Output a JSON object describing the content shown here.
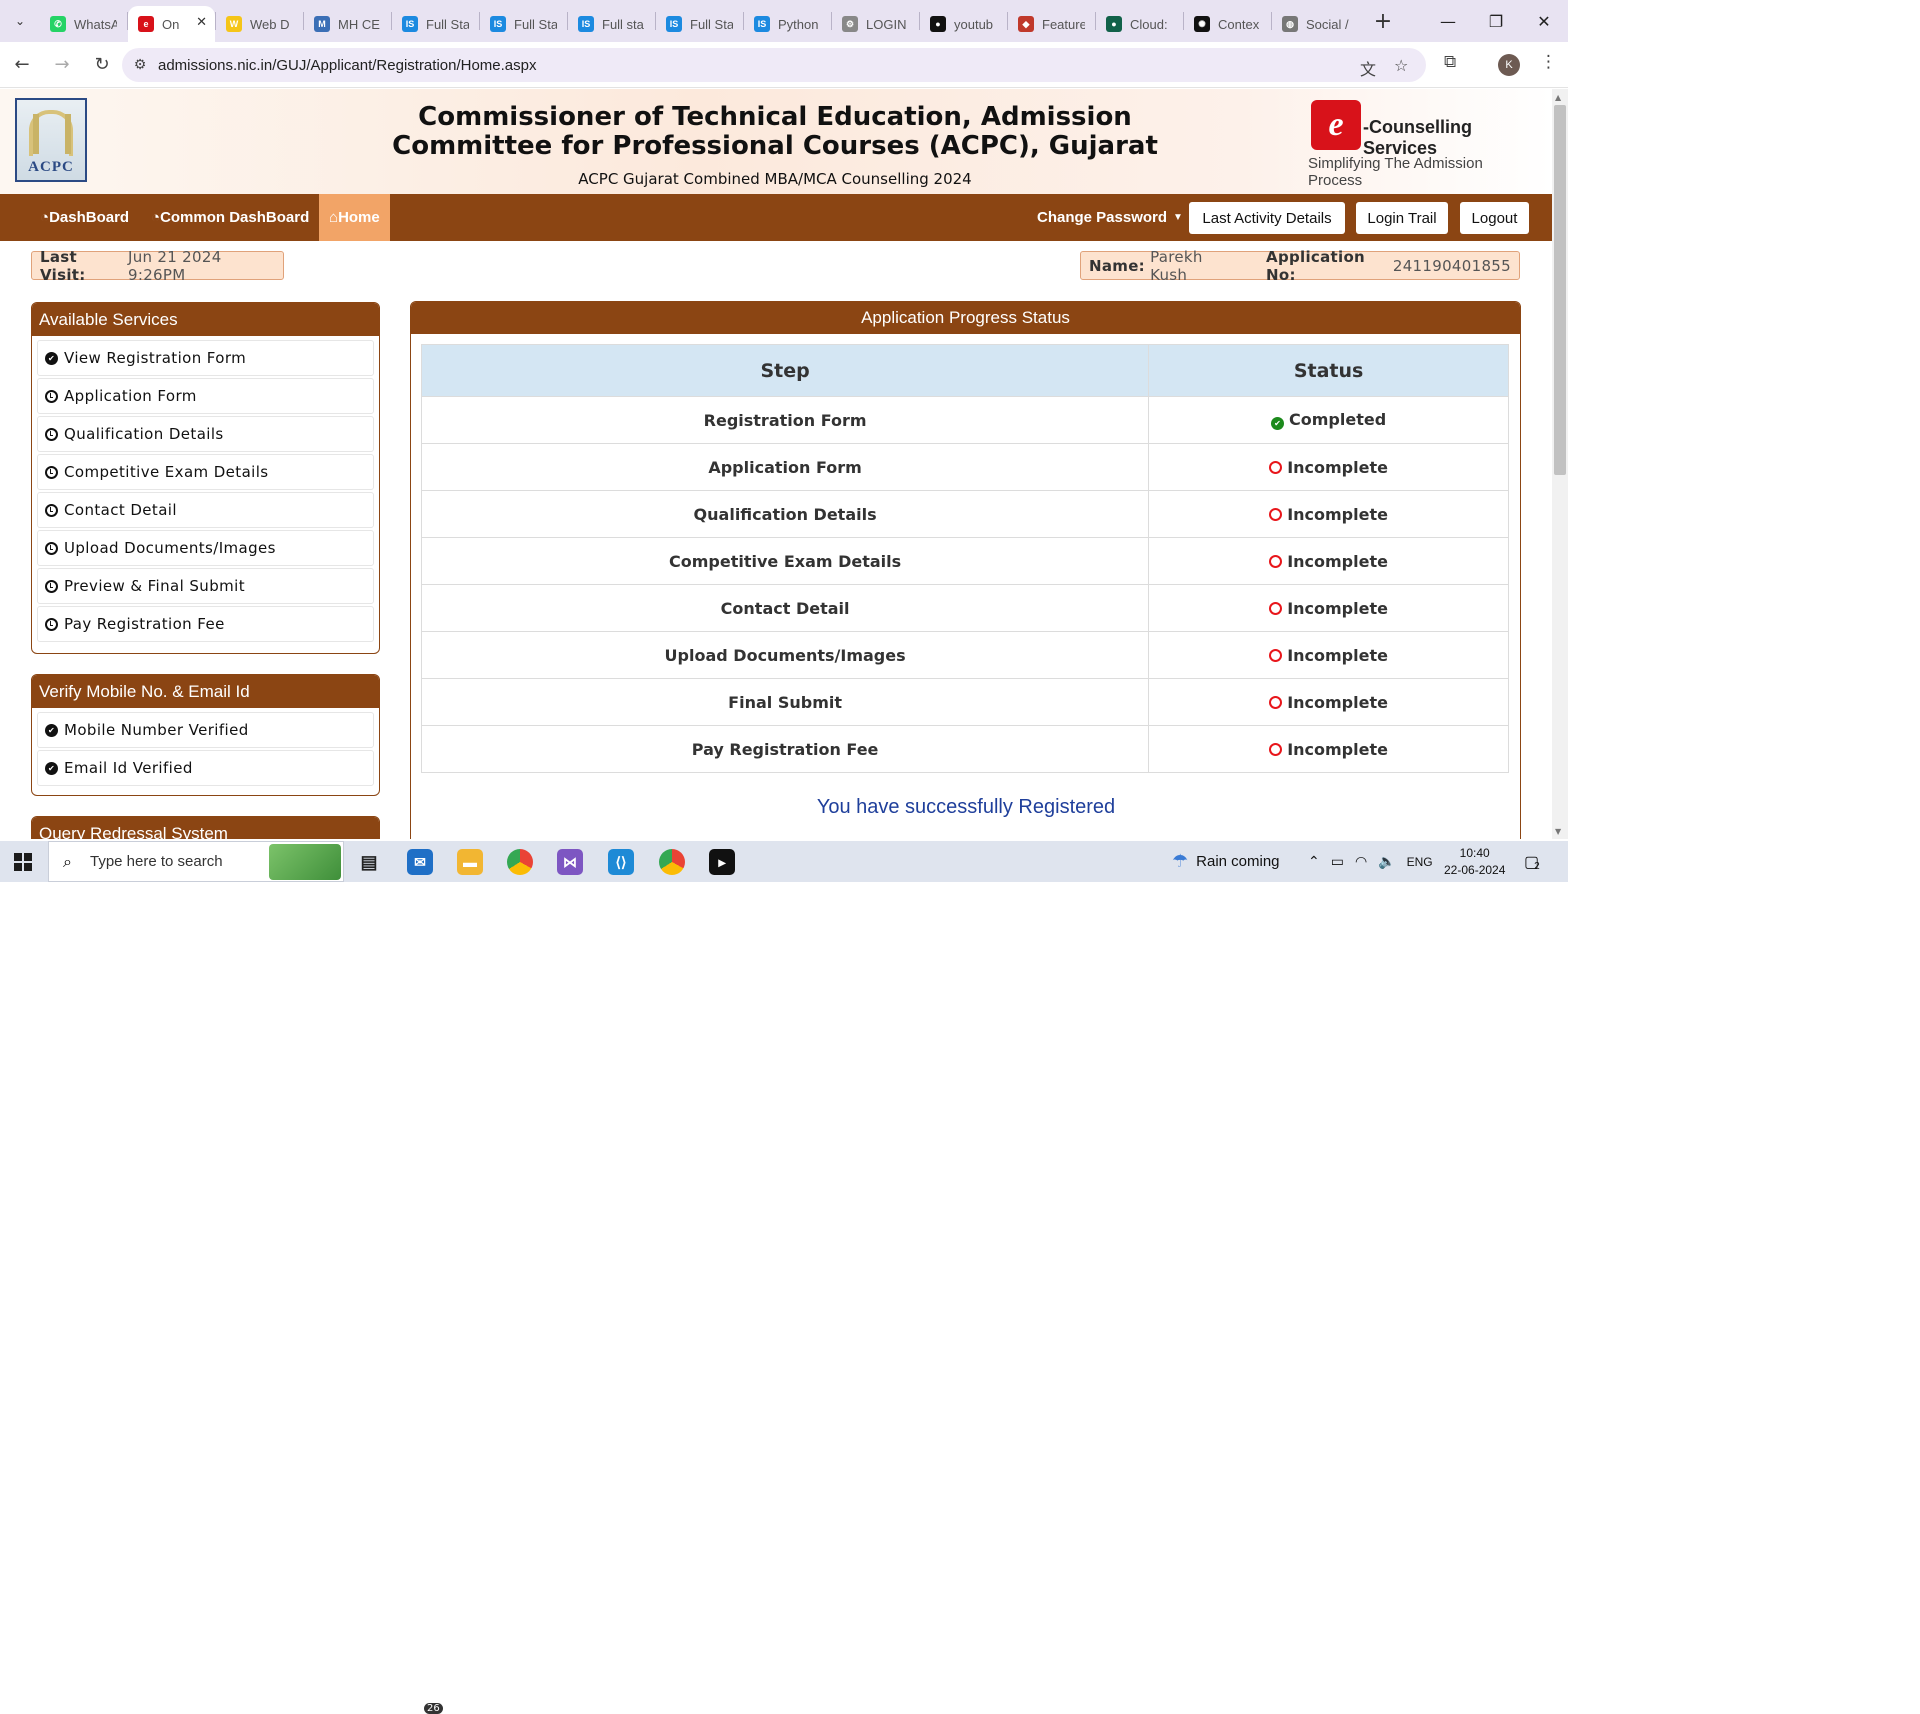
{
  "browser": {
    "tabs": [
      {
        "title": "WhatsA",
        "icon": "whatsapp-icon",
        "color": "#25d366",
        "glyph": "✆"
      },
      {
        "title": "On",
        "icon": "ecounselling-icon",
        "color": "#d8121a",
        "glyph": "e",
        "active": true
      },
      {
        "title": "Web D",
        "icon": "web-icon",
        "color": "#f5c518",
        "glyph": "W"
      },
      {
        "title": "MH CE",
        "icon": "mhcet-icon",
        "color": "#3b6fb6",
        "glyph": "M"
      },
      {
        "title": "Full Sta",
        "icon": "is-icon",
        "color": "#1c8ae0",
        "glyph": "IS"
      },
      {
        "title": "Full Sta",
        "icon": "is-icon",
        "color": "#1c8ae0",
        "glyph": "IS"
      },
      {
        "title": "Full sta",
        "icon": "is-icon",
        "color": "#1c8ae0",
        "glyph": "IS"
      },
      {
        "title": "Full Sta",
        "icon": "is-icon",
        "color": "#1c8ae0",
        "glyph": "IS"
      },
      {
        "title": "Python",
        "icon": "is-icon",
        "color": "#1c8ae0",
        "glyph": "IS"
      },
      {
        "title": "LOGIN",
        "icon": "login-icon",
        "color": "#888888",
        "glyph": "⚙"
      },
      {
        "title": "youtub",
        "icon": "github-icon",
        "color": "#111111",
        "glyph": "●"
      },
      {
        "title": "Feature",
        "icon": "feature-icon",
        "color": "#c0392b",
        "glyph": "◆"
      },
      {
        "title": "Cloud:",
        "icon": "mongodb-icon",
        "color": "#116149",
        "glyph": "●"
      },
      {
        "title": "Contex",
        "icon": "openai-icon",
        "color": "#111111",
        "glyph": "✺"
      },
      {
        "title": "Social /",
        "icon": "globe-icon",
        "color": "#777777",
        "glyph": "◍"
      }
    ],
    "url": "admissions.nic.in/GUJ/Applicant/Registration/Home.aspx",
    "profile_initial": "K"
  },
  "header": {
    "title": "Commissioner of Technical Education, Admission Committee for Professional Courses (ACPC), Gujarat",
    "subtitle": "ACPC Gujarat Combined MBA/MCA Counselling 2024",
    "logo_left_text": "ACPC",
    "logo_right_brand": "-Counselling Services",
    "logo_right_tagline": "Simplifying The Admission Process"
  },
  "nav": {
    "dashboard": "DashBoard",
    "common_dashboard": "Common DashBoard",
    "home": "Home",
    "change_password": "Change Password",
    "last_activity": "Last Activity Details",
    "login_trail": "Login Trail",
    "logout": "Logout"
  },
  "info": {
    "last_visit_label": "Last Visit:",
    "last_visit_value": "Jun 21 2024 9:26PM",
    "name_label": "Name:",
    "name_value": "Parekh Kush",
    "app_label": "Application No:",
    "app_value": "241190401855"
  },
  "services": {
    "title": "Available Services",
    "items": [
      {
        "label": "View Registration Form",
        "icon": "check-circle-icon"
      },
      {
        "label": "Application Form",
        "icon": "clock-icon"
      },
      {
        "label": "Qualification Details",
        "icon": "clock-icon"
      },
      {
        "label": "Competitive Exam Details",
        "icon": "clock-icon"
      },
      {
        "label": "Contact Detail",
        "icon": "clock-icon"
      },
      {
        "label": "Upload Documents/Images",
        "icon": "clock-icon"
      },
      {
        "label": "Preview & Final Submit",
        "icon": "clock-icon"
      },
      {
        "label": "Pay Registration Fee",
        "icon": "clock-icon"
      }
    ]
  },
  "verify": {
    "title": "Verify Mobile No. & Email Id",
    "items": [
      {
        "label": "Mobile Number Verified",
        "icon": "check-circle-icon"
      },
      {
        "label": "Email Id Verified",
        "icon": "check-circle-icon"
      }
    ]
  },
  "query": {
    "title": "Query Redressal System"
  },
  "progress": {
    "title": "Application Progress Status",
    "col_step": "Step",
    "col_status": "Status",
    "rows": [
      {
        "step": "Registration Form",
        "status": "Completed",
        "ok": true
      },
      {
        "step": "Application Form",
        "status": "Incomplete",
        "ok": false
      },
      {
        "step": "Qualification Details",
        "status": "Incomplete",
        "ok": false
      },
      {
        "step": "Competitive Exam Details",
        "status": "Incomplete",
        "ok": false
      },
      {
        "step": "Contact Detail",
        "status": "Incomplete",
        "ok": false
      },
      {
        "step": "Upload Documents/Images",
        "status": "Incomplete",
        "ok": false
      },
      {
        "step": "Final Submit",
        "status": "Incomplete",
        "ok": false
      },
      {
        "step": "Pay Registration Fee",
        "status": "Incomplete",
        "ok": false
      }
    ],
    "success_msg": "You have successfully Registered"
  },
  "colors": {
    "brand_brown": "#8b4513",
    "home_active": "#f2a467",
    "ok_green": "#1c8a1c",
    "bad_red": "#e8161b"
  },
  "taskbar": {
    "search_placeholder": "Type here to search",
    "weather": "Rain coming",
    "lang": "ENG",
    "time": "10:40",
    "date": "22-06-2024",
    "mail_badge": "26",
    "notif_count": "2"
  }
}
